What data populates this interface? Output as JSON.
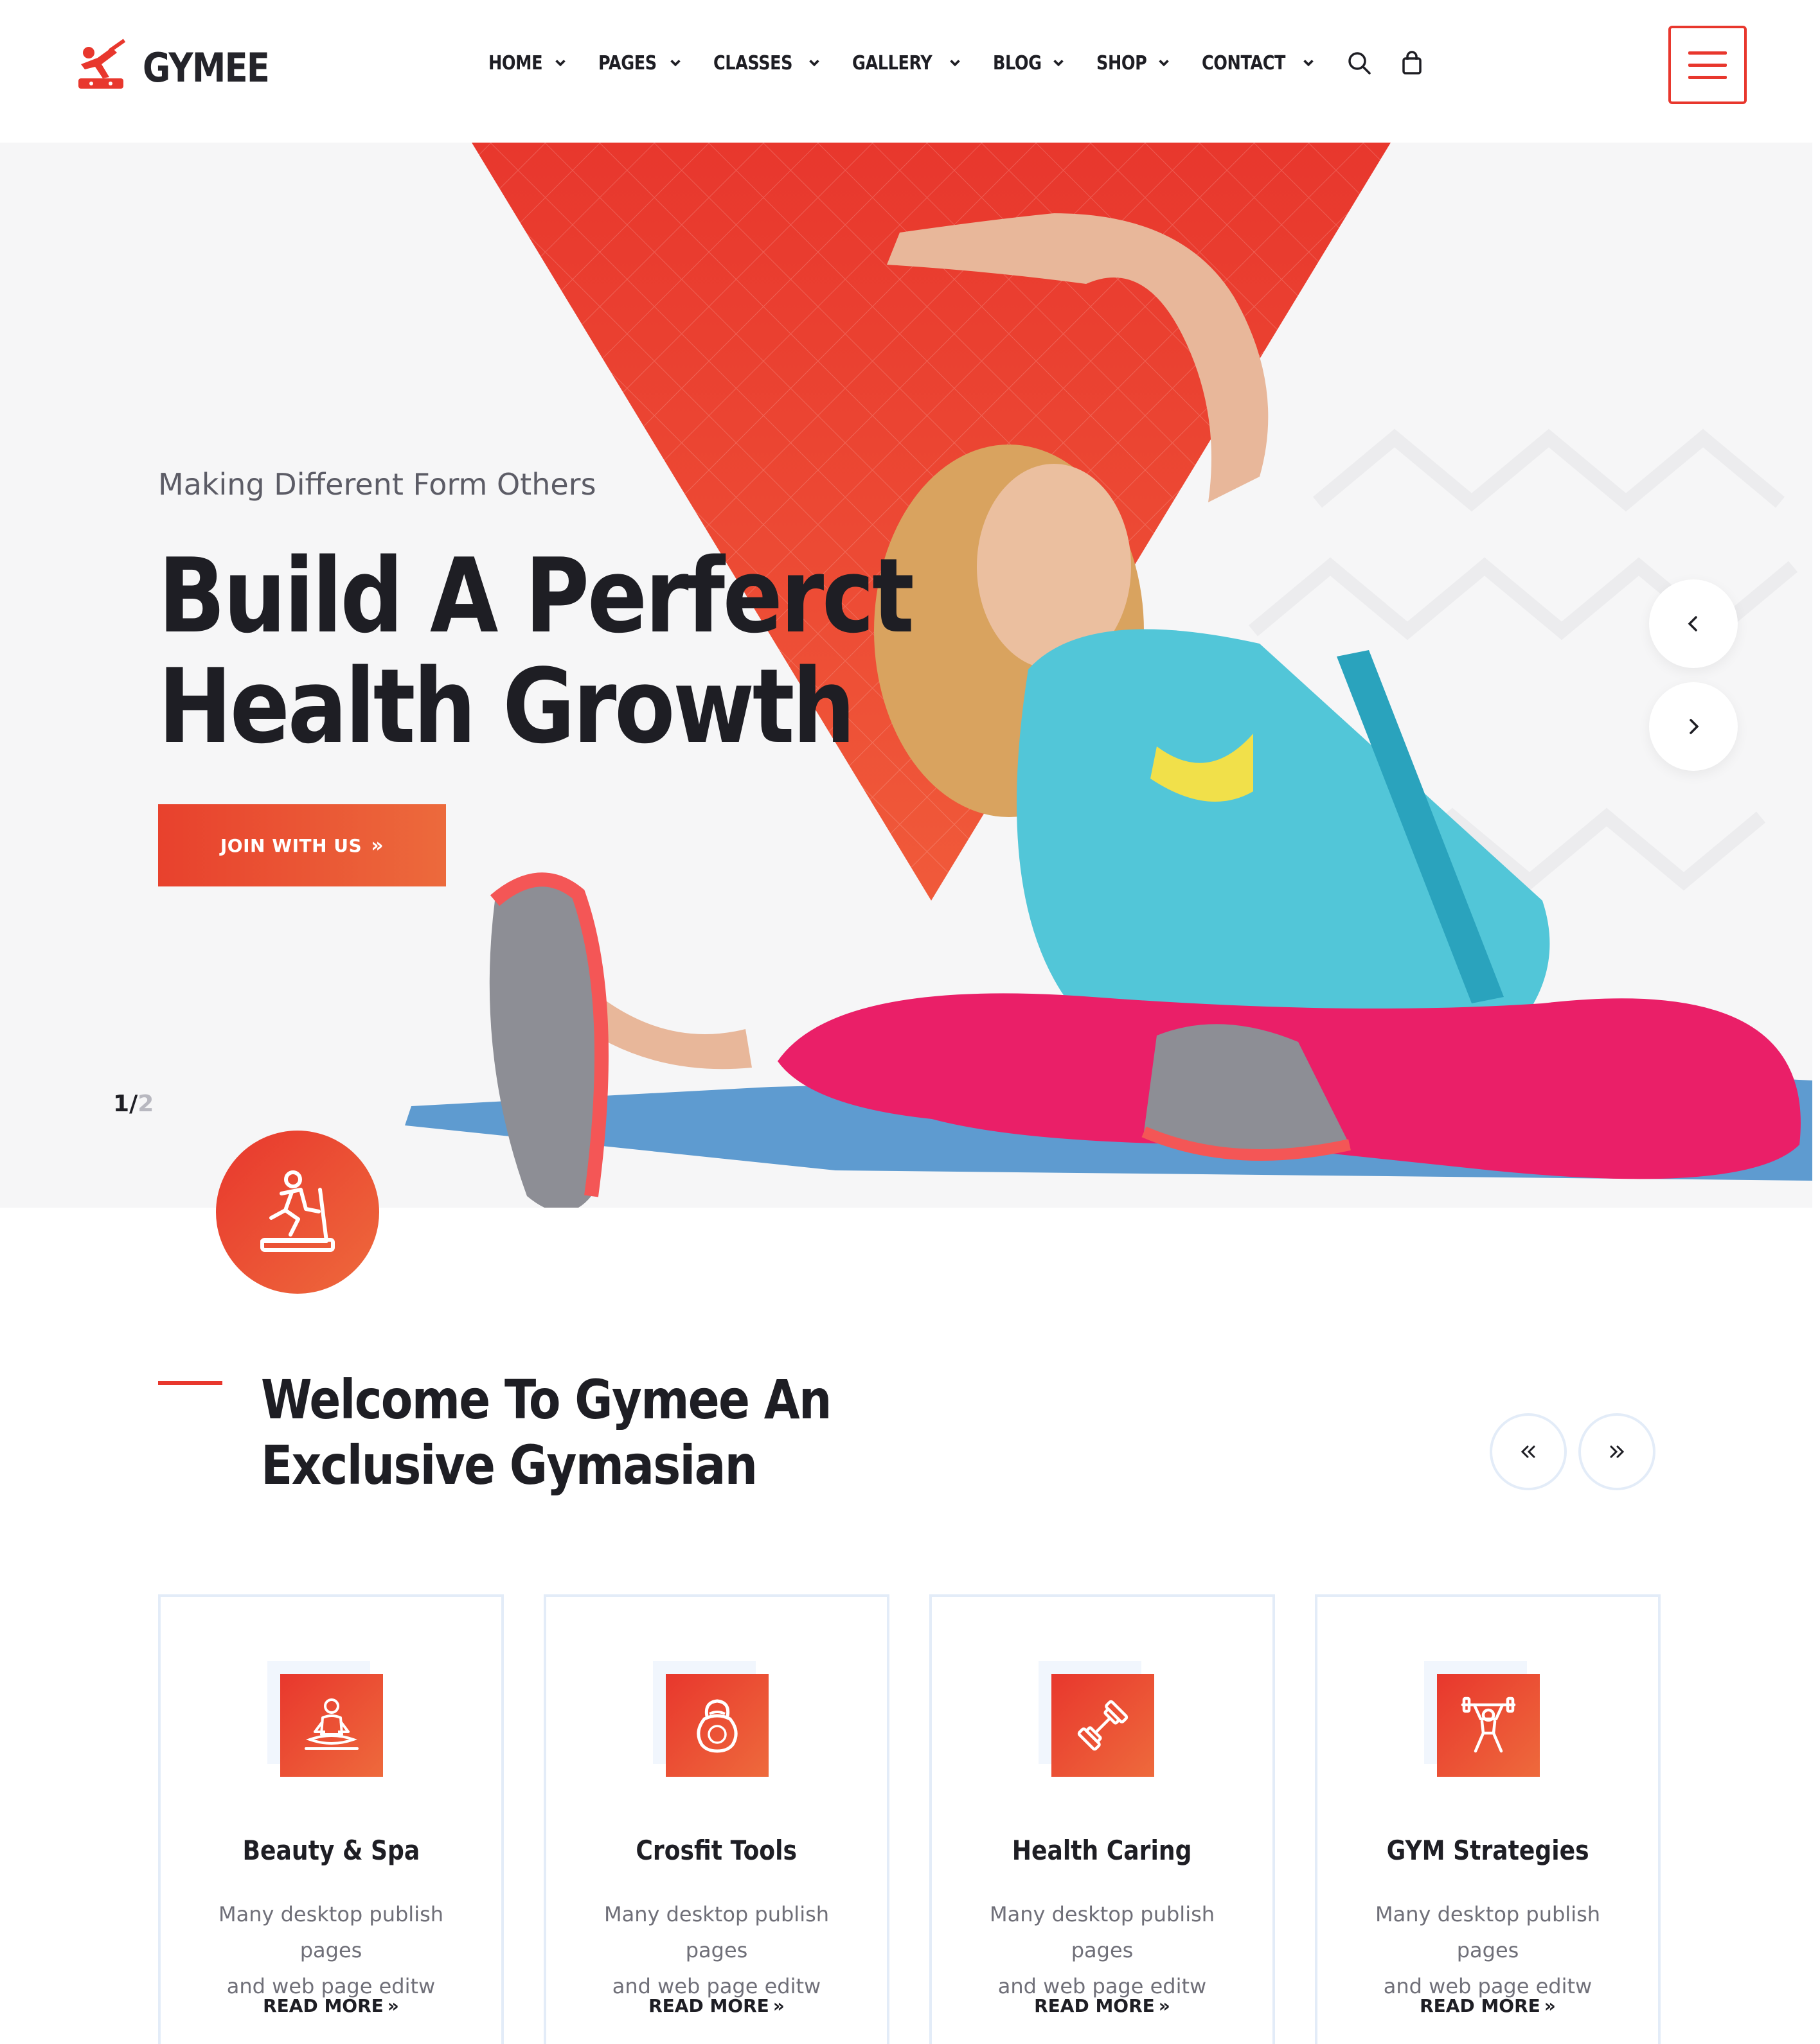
{
  "brand": {
    "name": "GYMEE",
    "accent": "#e8372d",
    "accent_2": "#ee6a3c"
  },
  "nav": {
    "items": [
      {
        "label": "HOME"
      },
      {
        "label": "PAGES"
      },
      {
        "label": "CLASSES"
      },
      {
        "label": "GALLERY"
      },
      {
        "label": "BLOG"
      },
      {
        "label": "SHOP"
      },
      {
        "label": "CONTACT"
      }
    ],
    "icons": [
      "search-icon",
      "cart-icon",
      "menu-icon"
    ]
  },
  "hero": {
    "subtitle": "Making Different Form Others",
    "title_line1": "Build A Perferct",
    "title_line2": "Health Growth",
    "cta_label": "JOIN WITH US",
    "cta_icon": "double-chevron-right-icon",
    "slide_current": "1",
    "slide_separator": "/",
    "slide_total": "2",
    "prev_icon": "chevron-left-icon",
    "next_icon": "chevron-right-icon",
    "badge_icon": "treadmill-icon"
  },
  "welcome": {
    "title_line1": "Welcome To Gymee An",
    "title_line2": "Exclusive Gymasian",
    "prev_icon": "double-chevron-left-icon",
    "next_icon": "double-chevron-right-icon"
  },
  "services": [
    {
      "title": "Beauty & Spa",
      "text_line1": "Many desktop publish pages",
      "text_line2": "and web page editw",
      "link": "READ MORE",
      "icon": "meditation-icon"
    },
    {
      "title": "Crosfit Tools",
      "text_line1": "Many desktop publish pages",
      "text_line2": "and web page editw",
      "link": "READ MORE",
      "icon": "kettlebell-icon"
    },
    {
      "title": "Health Caring",
      "text_line1": "Many desktop publish pages",
      "text_line2": "and web page editw",
      "link": "READ MORE",
      "icon": "dumbbell-icon"
    },
    {
      "title": "GYM Strategies",
      "text_line1": "Many desktop publish pages",
      "text_line2": "and web page editw",
      "link": "READ MORE",
      "icon": "weightlifter-icon"
    }
  ]
}
